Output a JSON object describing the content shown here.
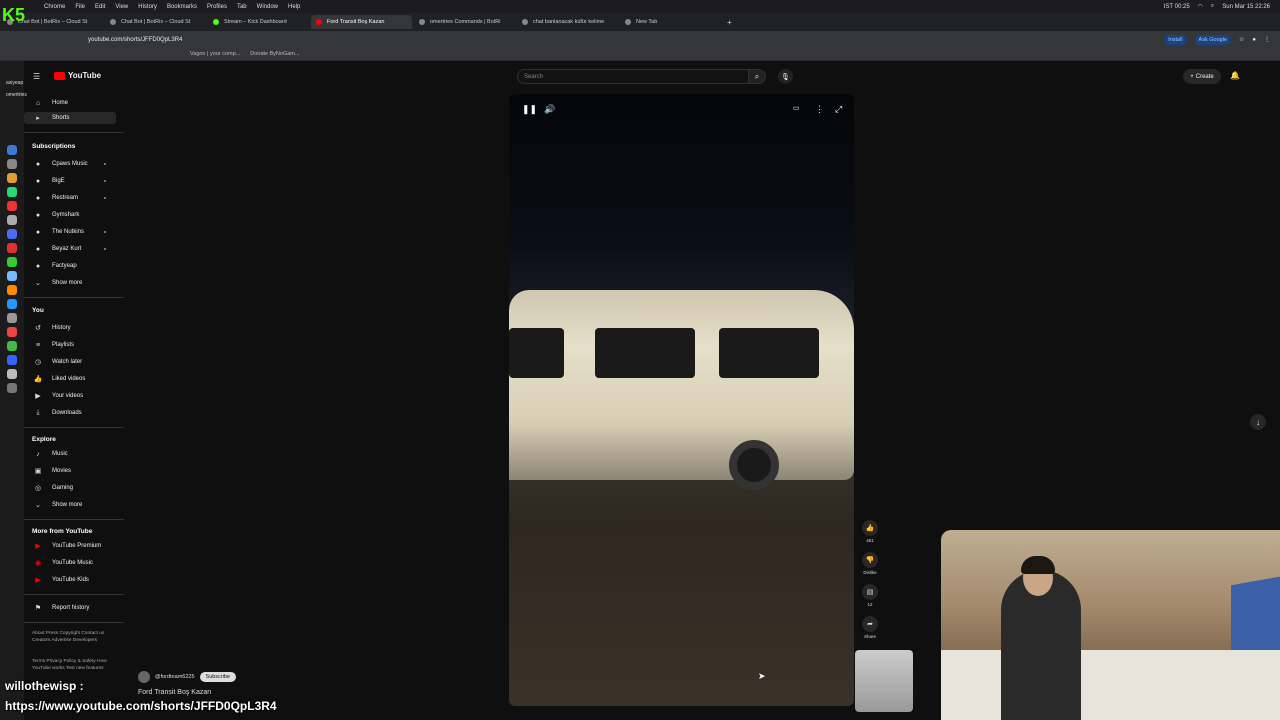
{
  "mac_menu": {
    "app": "Chrome",
    "items": [
      "File",
      "Edit",
      "View",
      "History",
      "Bookmarks",
      "Profiles",
      "Tab",
      "Window",
      "Help"
    ],
    "clock": "Sun Mar 15 22:26",
    "status": "IST 00:25"
  },
  "tabs": [
    {
      "label": "Chat Bot | BotRix – Cloud St"
    },
    {
      "label": "Chat Bot | BotRix – Cloud St"
    },
    {
      "label": "Stream – Kick Dashboard"
    },
    {
      "label": "Ford Transit Boş Kazan",
      "active": true
    },
    {
      "label": "omertries Commands | BotRi"
    },
    {
      "label": "chat banlanacak küfür kelime"
    },
    {
      "label": "New Tab"
    }
  ],
  "address": {
    "url": "youtube.com/shorts/JFFD0QpL3R4",
    "install": "Install",
    "ask_google": "Ask Google"
  },
  "bookmarks": [
    "Vagon | your comp...",
    "Donate ByNoGam..."
  ],
  "sidebar": {
    "home": "Home",
    "shorts": "Shorts",
    "subscriptions_title": "Subscriptions",
    "subscriptions": [
      "Cpaws Music",
      "BigE",
      "Restream",
      "Gymshark",
      "The Nutkins",
      "Beyaz Kurt",
      "Factyeap"
    ],
    "show_more": "Show more",
    "you_title": "You",
    "you_items": [
      "History",
      "Playlists",
      "Watch later",
      "Liked videos",
      "Your videos",
      "Downloads"
    ],
    "explore_title": "Explore",
    "explore_items": [
      "Music",
      "Movies",
      "Gaming"
    ],
    "explore_show_more": "Show more",
    "more_title": "More from YouTube",
    "more_items": [
      "YouTube Premium",
      "YouTube Music",
      "YouTube Kids"
    ],
    "report": "Report history",
    "footer1": "About  Press  Copyright  Contact us  Creators  Advertise  Developers",
    "footer2": "Terms  Privacy  Policy & Safety  How YouTube works  Test new features"
  },
  "dock_profiles": [
    "asiyeap",
    "omertries"
  ],
  "header": {
    "search_placeholder": "Search",
    "create": "Create",
    "logo": "YouTube"
  },
  "short": {
    "channel": "@fordteam6225",
    "subscribe": "Subscribe",
    "title": "Ford Transit Boş Kazan",
    "likes": "451",
    "dislike": "Dislike",
    "comments": "12",
    "share": "Share"
  },
  "overlay": {
    "chat_user": "willothewisp :",
    "chat_url": "https://www.youtube.com/shorts/JFFD0QpL3R4"
  },
  "colors": {
    "yt_red": "#ff0000",
    "kick_green": "#53fc18",
    "bg": "#0f0f0f"
  }
}
